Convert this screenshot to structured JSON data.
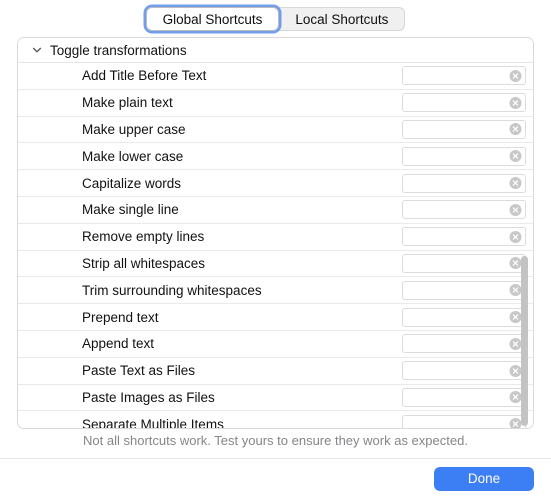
{
  "tabs": [
    {
      "label": "Global Shortcuts",
      "selected": true
    },
    {
      "label": "Local Shortcuts",
      "selected": false
    }
  ],
  "group": {
    "label": "Toggle transformations",
    "expanded": true,
    "chevron_icon": "chevron-down-icon"
  },
  "items": [
    {
      "label": "Add Title Before Text",
      "shortcut": "",
      "clear_icon": "clear-circle-icon"
    },
    {
      "label": "Make plain text",
      "shortcut": "",
      "clear_icon": "clear-circle-icon"
    },
    {
      "label": "Make upper case",
      "shortcut": "",
      "clear_icon": "clear-circle-icon"
    },
    {
      "label": "Make lower case",
      "shortcut": "",
      "clear_icon": "clear-circle-icon"
    },
    {
      "label": "Capitalize words",
      "shortcut": "",
      "clear_icon": "clear-circle-icon"
    },
    {
      "label": "Make single line",
      "shortcut": "",
      "clear_icon": "clear-circle-icon"
    },
    {
      "label": "Remove empty lines",
      "shortcut": "",
      "clear_icon": "clear-circle-icon"
    },
    {
      "label": "Strip all whitespaces",
      "shortcut": "",
      "clear_icon": "clear-circle-icon"
    },
    {
      "label": "Trim surrounding whitespaces",
      "shortcut": "",
      "clear_icon": "clear-circle-icon"
    },
    {
      "label": "Prepend text",
      "shortcut": "",
      "clear_icon": "clear-circle-icon"
    },
    {
      "label": "Append text",
      "shortcut": "",
      "clear_icon": "clear-circle-icon"
    },
    {
      "label": "Paste Text as Files",
      "shortcut": "",
      "clear_icon": "clear-circle-icon"
    },
    {
      "label": "Paste Images as Files",
      "shortcut": "",
      "clear_icon": "clear-circle-icon"
    },
    {
      "label": "Separate Multiple Items",
      "shortcut": "",
      "clear_icon": "clear-circle-icon"
    }
  ],
  "footer": {
    "note": "Not all shortcuts work. Test yours to ensure they work as expected.",
    "done_label": "Done"
  },
  "colors": {
    "accent": "#3c7ef4",
    "focus_ring": "#5a8ceb",
    "note_text": "#86868a",
    "scrollbar_thumb": "#c3c3c3"
  }
}
